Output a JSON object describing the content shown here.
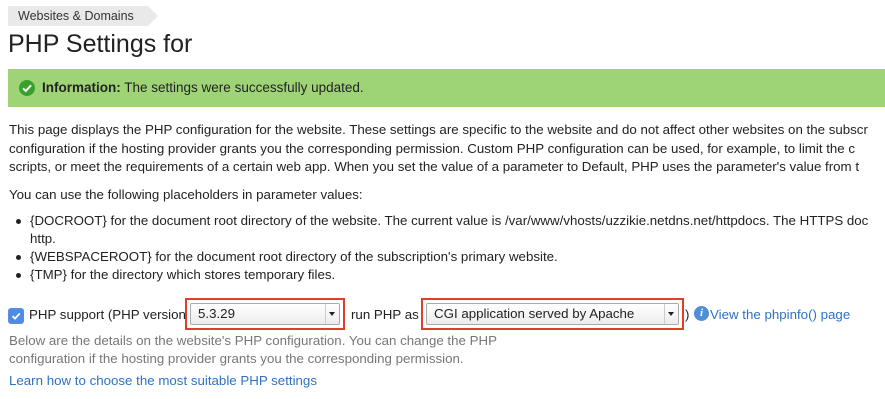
{
  "breadcrumb": {
    "label": "Websites & Domains"
  },
  "page_title": "PHP Settings for",
  "info": {
    "label": "Information:",
    "message": "The settings were successfully updated."
  },
  "description": {
    "line1": "This page displays the PHP configuration for the website. These settings are specific to the website and do not affect other websites on the subscr",
    "line2": "configuration if the hosting provider grants you the corresponding permission. Custom PHP configuration can be used, for example, to limit the c",
    "line3": "scripts, or meet the requirements of a certain web app. When you set the value of a parameter to Default, PHP uses the parameter's value from t"
  },
  "placeholders_intro": "You can use the following placeholders in parameter values:",
  "placeholders": [
    {
      "line1": "{DOCROOT} for the document root directory of the website. The current value is /var/www/vhosts/uzzikie.netdns.net/httpdocs. The HTTPS doc",
      "line2": "http."
    },
    {
      "line1": "{WEBSPACEROOT} for the document root directory of the subscription's primary website."
    },
    {
      "line1": "{TMP} for the directory which stores temporary files."
    }
  ],
  "php_support": {
    "checked": true,
    "label_prefix": "PHP support (PHP version",
    "version_value": "5.3.29",
    "run_as_label": "run PHP as",
    "handler_value": "CGI application served by Apache",
    "close_paren": ")",
    "help_icon_glyph": "i",
    "phpinfo_link": "View the phpinfo() page"
  },
  "details": {
    "line1": "Below are the details on the website's PHP configuration. You can change the PHP",
    "line2": "configuration if the hosting provider grants you the corresponding permission."
  },
  "learn_link": "Learn how to choose the most suitable PHP settings",
  "colors": {
    "accent": "#2e72c5",
    "success_bar": "#9fd476",
    "highlight": "#d9412a"
  }
}
